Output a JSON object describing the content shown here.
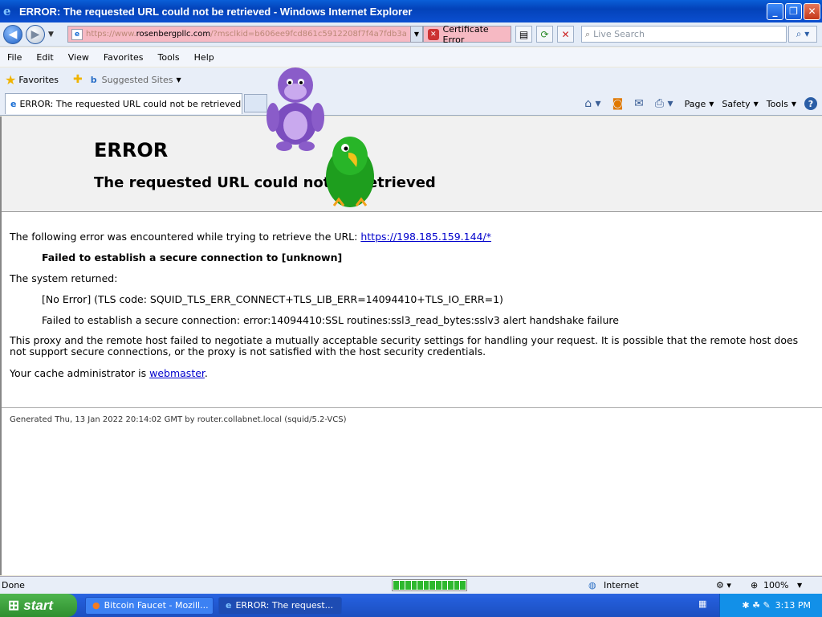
{
  "window": {
    "title": "ERROR: The requested URL could not be retrieved - Windows Internet Explorer",
    "min": "_",
    "max": "❐",
    "close": "✕"
  },
  "address": {
    "url_prefix": "https://www.",
    "url_host": "rosenbergpllc.com",
    "url_rest": "/?msclkid=b606ee9fcd861c5912208f7f4a7fdb3a",
    "cert_error": "Certificate Error",
    "search_placeholder": "Live Search"
  },
  "menu": {
    "items": [
      "File",
      "Edit",
      "View",
      "Favorites",
      "Tools",
      "Help"
    ]
  },
  "favorites": {
    "label": "Favorites",
    "suggested": "Suggested Sites"
  },
  "tab": {
    "title": "ERROR: The requested URL could not be retrieved"
  },
  "commandbar": {
    "page": "Page",
    "safety": "Safety",
    "tools": "Tools"
  },
  "page": {
    "h1": "ERROR",
    "h2": "The requested URL could not be retrieved",
    "p1_text": "The following error was encountered while trying to retrieve the URL: ",
    "p1_link": "https://198.185.159.144/*",
    "fail_bold": "Failed to establish a secure connection to [unknown]",
    "system_returned": "The system returned:",
    "no_error": "[No Error] (TLS code: SQUID_TLS_ERR_CONNECT+TLS_LIB_ERR=14094410+TLS_IO_ERR=1)",
    "ssl_fail": "Failed to establish a secure connection: error:14094410:SSL routines:ssl3_read_bytes:sslv3 alert handshake failure",
    "proxy_text": "This proxy and the remote host failed to negotiate a mutually acceptable security settings for handling your request. It is possible that the remote host does not support secure connections, or the proxy is not satisfied with the host security credentials.",
    "cache_text": "Your cache administrator is ",
    "cache_link": "webmaster",
    "cache_end": ".",
    "generated": "Generated Thu, 13 Jan 2022 20:14:02 GMT by router.collabnet.local (squid/5.2-VCS)"
  },
  "status": {
    "left": "Done",
    "zone": "Internet",
    "zoom": "100%"
  },
  "taskbar": {
    "start": "start",
    "btn1": "Bitcoin Faucet - Mozill...",
    "btn2": "ERROR: The request...",
    "time": "3:13 PM"
  },
  "colors": {
    "accent": "#0342b9",
    "cert_error_bg": "#f6b9c3",
    "link": "#0000cc"
  }
}
